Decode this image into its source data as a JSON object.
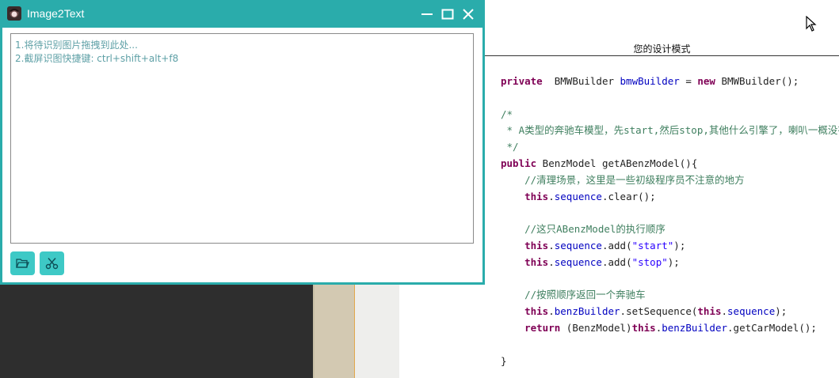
{
  "app": {
    "title": "Image2Text",
    "hint_lines": [
      "1.将待识别图片拖拽到此处...",
      "2.截屏识图快捷键: ctrl+shift+alt+f8"
    ],
    "toolbar": {
      "open_icon": "folder-open-icon",
      "cut_icon": "scissors-icon"
    },
    "window_controls": [
      "minimize-icon",
      "maximize-icon",
      "close-icon"
    ],
    "accent_color": "#2aacab"
  },
  "page": {
    "heading": "您的设计模式",
    "code_lines": [
      [
        [
          "kw",
          "private"
        ],
        [
          "",
          "  BMWBuilder "
        ],
        [
          "fld",
          "bmwBuilder"
        ],
        [
          "",
          " = "
        ],
        [
          "kw",
          "new"
        ],
        [
          "",
          " BMWBuilder();"
        ]
      ],
      [],
      [
        [
          "cm",
          "/*"
        ]
      ],
      [
        [
          "cm",
          " * A类型的奔驰车模型，先start,然后stop,其他什么引擎了，喇叭一概没有"
        ]
      ],
      [
        [
          "cm",
          " */"
        ]
      ],
      [
        [
          "kw",
          "public"
        ],
        [
          "",
          " BenzModel getABenzModel(){"
        ]
      ],
      [
        [
          "cm",
          "    //清理场景，这里是一些初级程序员不注意的地方"
        ]
      ],
      [
        [
          "kw",
          "    this"
        ],
        [
          "",
          "."
        ],
        [
          "fld",
          "sequence"
        ],
        [
          "",
          ".clear();"
        ]
      ],
      [],
      [
        [
          "cm",
          "    //这只ABenzModel的执行顺序"
        ]
      ],
      [
        [
          "kw",
          "    this"
        ],
        [
          "",
          "."
        ],
        [
          "fld",
          "sequence"
        ],
        [
          "",
          ".add("
        ],
        [
          "str",
          "\"start\""
        ],
        [
          "",
          ");"
        ]
      ],
      [
        [
          "kw",
          "    this"
        ],
        [
          "",
          "."
        ],
        [
          "fld",
          "sequence"
        ],
        [
          "",
          ".add("
        ],
        [
          "str",
          "\"stop\""
        ],
        [
          "",
          ");"
        ]
      ],
      [],
      [
        [
          "cm",
          "    //按照顺序返回一个奔驰车"
        ]
      ],
      [
        [
          "kw",
          "    this"
        ],
        [
          "",
          "."
        ],
        [
          "fld",
          "benzBuilder"
        ],
        [
          "",
          ".setSequence("
        ],
        [
          "kw",
          "this"
        ],
        [
          "",
          "."
        ],
        [
          "fld",
          "sequence"
        ],
        [
          "",
          ");"
        ]
      ],
      [
        [
          "kw",
          "    return"
        ],
        [
          "",
          " (BenzModel)"
        ],
        [
          "kw",
          "this"
        ],
        [
          "",
          "."
        ],
        [
          "fld",
          "benzBuilder"
        ],
        [
          "",
          ".getCarModel();"
        ]
      ],
      [],
      [
        [
          "",
          "}"
        ]
      ]
    ]
  }
}
